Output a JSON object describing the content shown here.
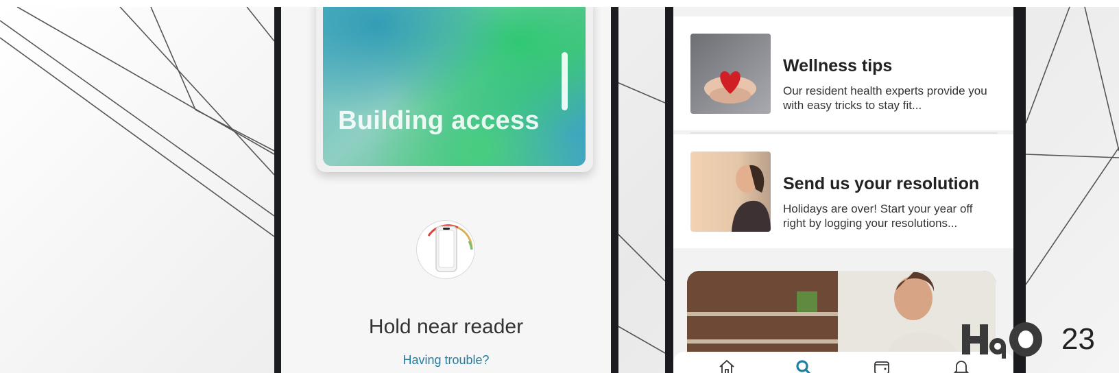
{
  "card": {
    "title": "Building access"
  },
  "reader": {
    "instruction": "Hold near reader",
    "help_link": "Having trouble?"
  },
  "articles": [
    {
      "title": "Wellness tips",
      "description": "Our resident health experts provide you with easy tricks to stay fit..."
    },
    {
      "title": "Send us your resolution",
      "description": "Holidays are over! Start your year off right by logging your resolutions..."
    }
  ],
  "tabs": [
    {
      "icon": "home-icon",
      "active": false
    },
    {
      "icon": "search-icon",
      "active": true
    },
    {
      "icon": "wallet-icon",
      "active": false
    },
    {
      "icon": "bell-icon",
      "active": false
    }
  ],
  "colors": {
    "accent": "#1f7fa3",
    "phone_frame": "#1c1d21"
  },
  "page_number": "23"
}
